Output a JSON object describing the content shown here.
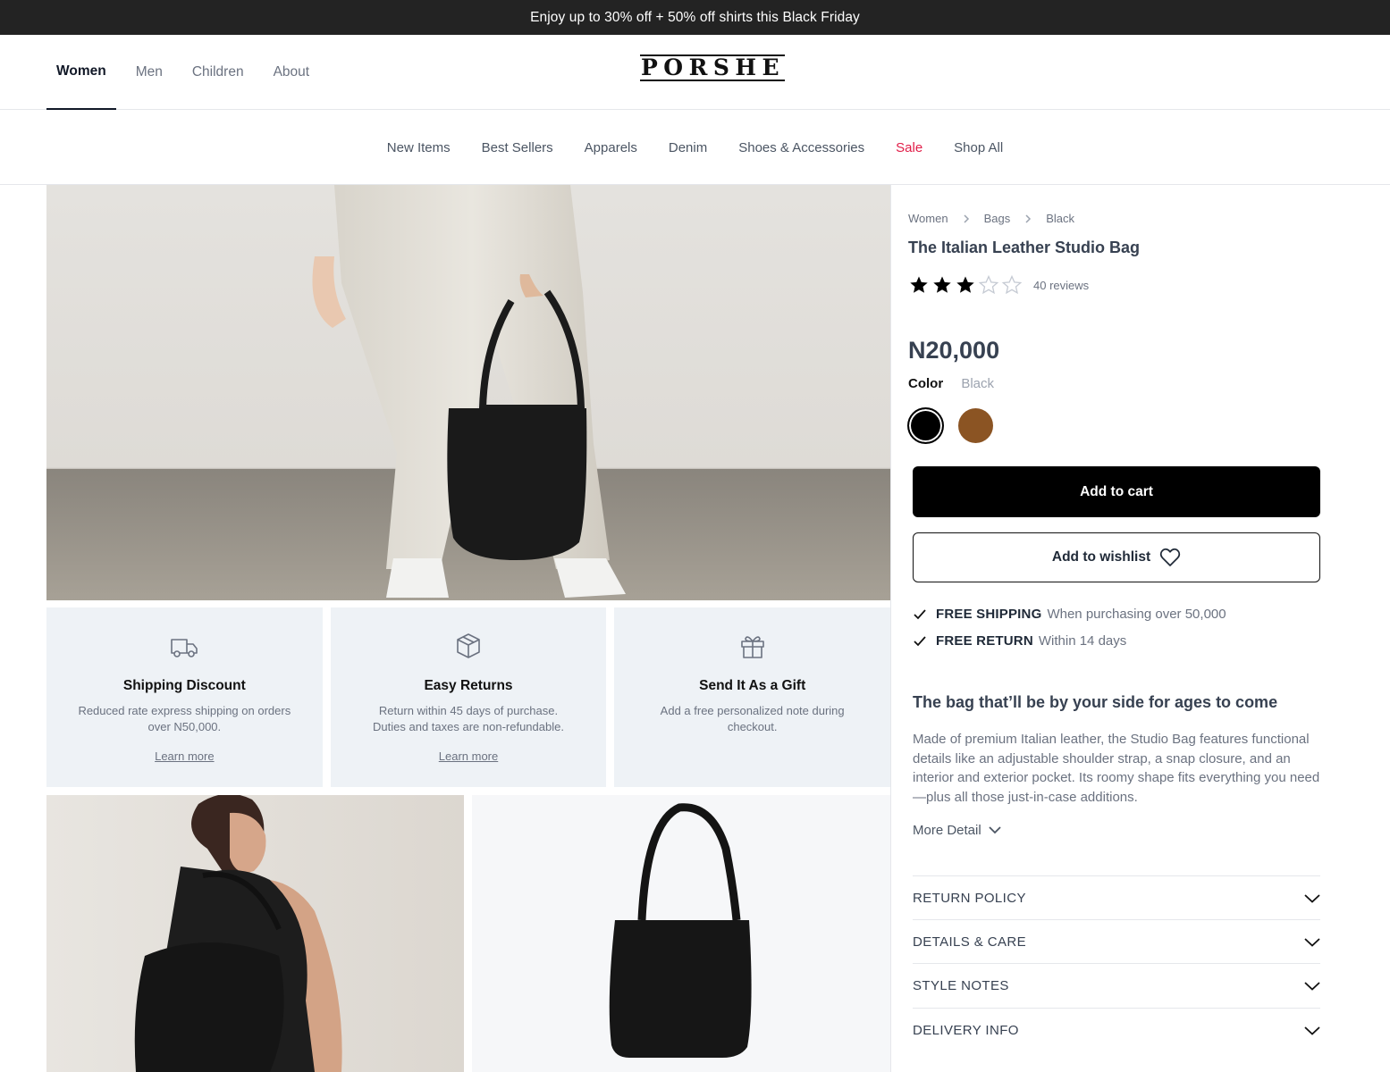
{
  "announcement": "Enjoy up to 30% off + 50% off shirts this Black Friday",
  "brand": "PORSHE",
  "gender_nav": [
    {
      "label": "Women",
      "active": true
    },
    {
      "label": "Men",
      "active": false
    },
    {
      "label": "Children",
      "active": false
    },
    {
      "label": "About",
      "active": false
    }
  ],
  "category_nav": [
    "New Items",
    "Best Sellers",
    "Apparels",
    "Denim",
    "Shoes & Accessories",
    "Sale",
    "Shop All"
  ],
  "perks": [
    {
      "icon": "truck-icon",
      "title": "Shipping Discount",
      "text": "Reduced rate express shipping on orders over N50,000.",
      "link": "Learn more"
    },
    {
      "icon": "box-icon",
      "title": "Easy Returns",
      "text": "Return within 45 days of purchase. Duties and taxes are non-refundable.",
      "link": "Learn more"
    },
    {
      "icon": "gift-icon",
      "title": "Send It As a Gift",
      "text": "Add a free personalized note during checkout.",
      "link": ""
    }
  ],
  "product": {
    "breadcrumb": [
      "Women",
      "Bags",
      "Black"
    ],
    "title": "The Italian Leather Studio Bag",
    "rating": 3,
    "rating_max": 5,
    "reviews": "40 reviews",
    "price": "N20,000",
    "color_label": "Color",
    "color_value": "Black",
    "swatches": [
      {
        "name": "Black",
        "hex": "#000000",
        "selected": true
      },
      {
        "name": "Brown",
        "hex": "#8b5423",
        "selected": false
      }
    ],
    "add_to_cart": "Add to cart",
    "add_to_wishlist": "Add to wishlist",
    "shipping_bold": "FREE SHIPPING",
    "shipping_text": "When purchasing over 50,000",
    "return_bold": "FREE RETURN",
    "return_text": "Within 14 days",
    "description_heading": "The bag that’ll be by your side for ages to come",
    "description": "Made of premium Italian leather, the Studio Bag features functional details like an adjustable shoulder strap, a snap closure, and an interior and exterior pocket. Its roomy shape fits everything you need—plus all those just-in-case additions.",
    "more_detail": "More Detail",
    "accordions": [
      "RETURN POLICY",
      "DETAILS & CARE",
      "STYLE NOTES",
      "DELIVERY INFO"
    ]
  },
  "colors": {
    "sale": "#e11d48",
    "perk_bg": "#eef2f6",
    "button": "#000000"
  }
}
